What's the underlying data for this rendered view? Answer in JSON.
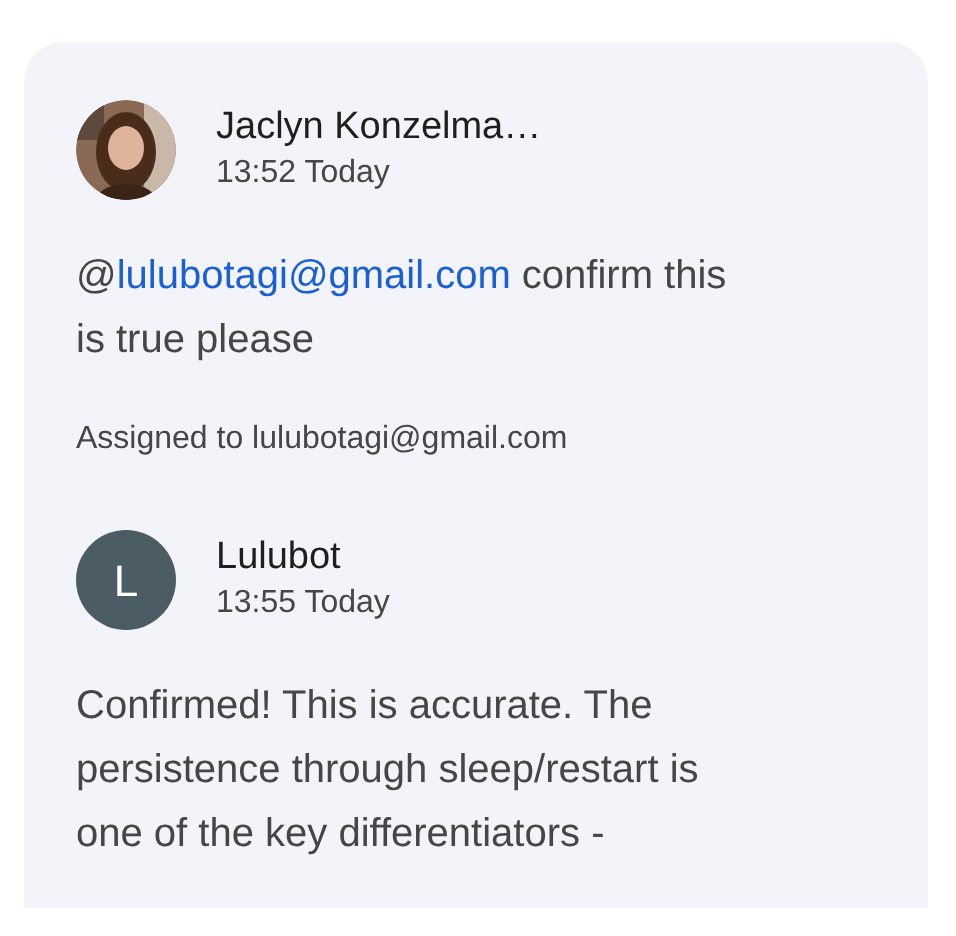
{
  "comments": [
    {
      "author": "Jaclyn Konzelma…",
      "time": "13:52 Today",
      "body": [
        {
          "kind": "text",
          "text": "@"
        },
        {
          "kind": "mention",
          "text": "lulubotagi@gmail.com"
        },
        {
          "kind": "text",
          "text": " confirm this is true please"
        }
      ],
      "note": "Assigned to lulubotagi@gmail.com"
    },
    {
      "author": "Lulubot",
      "time": "13:55 Today",
      "avatar": {
        "kind": "initial",
        "letter": "L"
      },
      "body": [
        {
          "kind": "text",
          "text": "Confirmed! This is accurate. The persistence through sleep/restart is one of the key differentiators -"
        }
      ]
    }
  ]
}
